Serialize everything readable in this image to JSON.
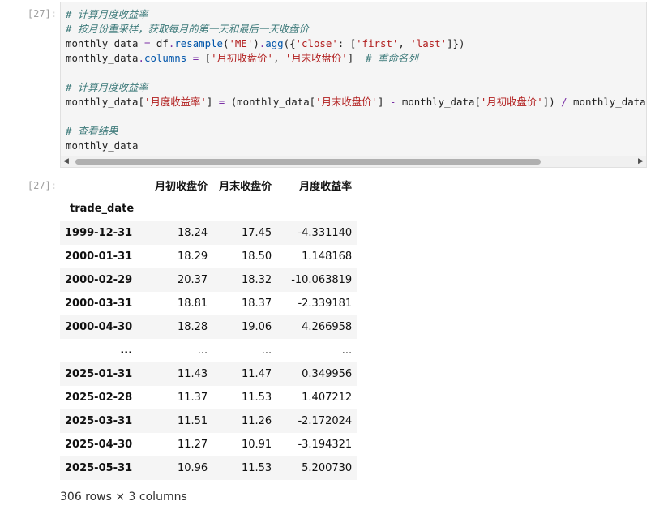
{
  "input_prompt": "[27]:",
  "output_prompt": "[27]:",
  "code_lines": [
    [
      {
        "t": "# 计算月度收益率",
        "c": "cm"
      }
    ],
    [
      {
        "t": "# 按月份重采样，获取每月的第一天和最后一天收盘价",
        "c": "cm"
      }
    ],
    [
      {
        "t": "monthly_data ",
        "c": ""
      },
      {
        "t": "=",
        "c": "op"
      },
      {
        "t": " df",
        "c": ""
      },
      {
        "t": ".",
        "c": "op"
      },
      {
        "t": "resample",
        "c": "fn"
      },
      {
        "t": "(",
        "c": ""
      },
      {
        "t": "'ME'",
        "c": "st"
      },
      {
        "t": ")",
        "c": ""
      },
      {
        "t": ".",
        "c": "op"
      },
      {
        "t": "agg",
        "c": "fn"
      },
      {
        "t": "({",
        "c": ""
      },
      {
        "t": "'close'",
        "c": "st"
      },
      {
        "t": ": [",
        "c": ""
      },
      {
        "t": "'first'",
        "c": "st"
      },
      {
        "t": ", ",
        "c": ""
      },
      {
        "t": "'last'",
        "c": "st"
      },
      {
        "t": "]})",
        "c": ""
      }
    ],
    [
      {
        "t": "monthly_data",
        "c": ""
      },
      {
        "t": ".",
        "c": "op"
      },
      {
        "t": "columns",
        "c": "fn"
      },
      {
        "t": " ",
        "c": ""
      },
      {
        "t": "=",
        "c": "op"
      },
      {
        "t": " [",
        "c": ""
      },
      {
        "t": "'月初收盘价'",
        "c": "st"
      },
      {
        "t": ", ",
        "c": ""
      },
      {
        "t": "'月末收盘价'",
        "c": "st"
      },
      {
        "t": "]  ",
        "c": ""
      },
      {
        "t": "# 重命名列",
        "c": "cm"
      }
    ],
    [],
    [
      {
        "t": "# 计算月度收益率",
        "c": "cm"
      }
    ],
    [
      {
        "t": "monthly_data[",
        "c": ""
      },
      {
        "t": "'月度收益率'",
        "c": "st"
      },
      {
        "t": "] ",
        "c": ""
      },
      {
        "t": "=",
        "c": "op"
      },
      {
        "t": " (monthly_data[",
        "c": ""
      },
      {
        "t": "'月末收盘价'",
        "c": "st"
      },
      {
        "t": "] ",
        "c": ""
      },
      {
        "t": "-",
        "c": "op"
      },
      {
        "t": " monthly_data[",
        "c": ""
      },
      {
        "t": "'月初收盘价'",
        "c": "st"
      },
      {
        "t": "]) ",
        "c": ""
      },
      {
        "t": "/",
        "c": "op"
      },
      {
        "t": " monthly_data",
        "c": ""
      }
    ],
    [],
    [
      {
        "t": "# 查看结果",
        "c": "cm"
      }
    ],
    [
      {
        "t": "monthly_data",
        "c": ""
      }
    ]
  ],
  "table": {
    "columns": [
      "月初收盘价",
      "月末收盘价",
      "月度收益率"
    ],
    "index_name": "trade_date",
    "rows": [
      {
        "index": "1999-12-31",
        "values": [
          "18.24",
          "17.45",
          "-4.331140"
        ]
      },
      {
        "index": "2000-01-31",
        "values": [
          "18.29",
          "18.50",
          "1.148168"
        ]
      },
      {
        "index": "2000-02-29",
        "values": [
          "20.37",
          "18.32",
          "-10.063819"
        ]
      },
      {
        "index": "2000-03-31",
        "values": [
          "18.81",
          "18.37",
          "-2.339181"
        ]
      },
      {
        "index": "2000-04-30",
        "values": [
          "18.28",
          "19.06",
          "4.266958"
        ]
      },
      {
        "index": "...",
        "values": [
          "...",
          "...",
          "..."
        ]
      },
      {
        "index": "2025-01-31",
        "values": [
          "11.43",
          "11.47",
          "0.349956"
        ]
      },
      {
        "index": "2025-02-28",
        "values": [
          "11.37",
          "11.53",
          "1.407212"
        ]
      },
      {
        "index": "2025-03-31",
        "values": [
          "11.51",
          "11.26",
          "-2.172024"
        ]
      },
      {
        "index": "2025-04-30",
        "values": [
          "11.27",
          "10.91",
          "-3.194321"
        ]
      },
      {
        "index": "2025-05-31",
        "values": [
          "10.96",
          "11.53",
          "5.200730"
        ]
      }
    ]
  },
  "shape_text": "306 rows × 3 columns",
  "scrollbar": {
    "left_arrow_icon": "triangle-left-icon",
    "right_arrow_icon": "triangle-right-icon",
    "left_glyph": "◀",
    "right_glyph": "▶"
  }
}
